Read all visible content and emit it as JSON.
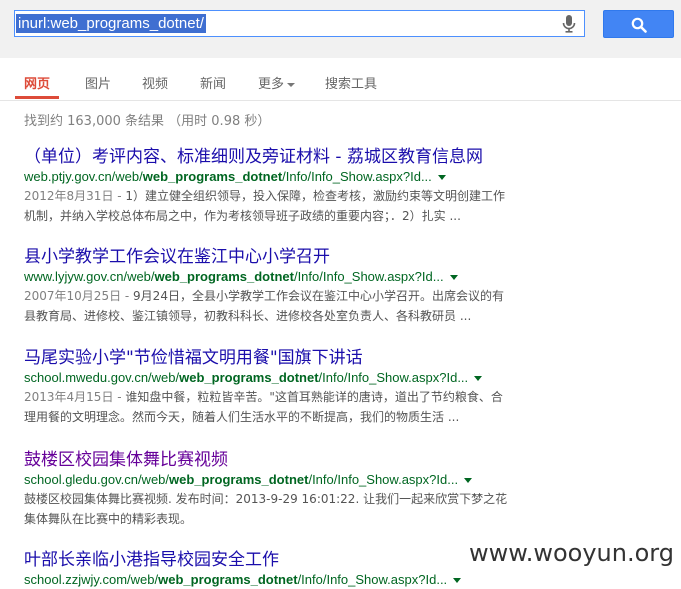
{
  "search": {
    "query": "inurl:web_programs_dotnet/"
  },
  "tabs": [
    {
      "label": "网页"
    },
    {
      "label": "图片"
    },
    {
      "label": "视频"
    },
    {
      "label": "新闻"
    },
    {
      "label": "更多"
    },
    {
      "label": "搜索工具"
    }
  ],
  "stats": "找到约 163,000 条结果 （用时 0.98 秒）",
  "results": [
    {
      "title": "（单位）考评内容、标准细则及旁证材料 - 荔城区教育信息网",
      "url_pre": "web.ptjy.gov.cn/web/",
      "url_bold": "web_programs_dotnet",
      "url_post": "/Info/Info_Show.aspx?Id...",
      "date": "2012年8月31日 - ",
      "line1": "1）建立健全组织领导，投入保障，检查考核，激励约束等文明创建工作",
      "line2": "机制，并纳入学校总体布局之中，作为考核领导班子政绩的重要内容；．2）扎实 ..."
    },
    {
      "title": "县小学教学工作会议在鉴江中心小学召开",
      "url_pre": "www.lyjyw.gov.cn/web/",
      "url_bold": "web_programs_dotnet",
      "url_post": "/Info/Info_Show.aspx?Id...",
      "date": "2007年10月25日 - ",
      "line1": "9月24日，全县小学教学工作会议在鉴江中心小学召开。出席会议的有",
      "line2": "县教育局、进修校、鉴江镇领导，初教科科长、进修校各处室负责人、各科教研员 ..."
    },
    {
      "title": "马尾实验小学\"节俭惜福文明用餐\"国旗下讲话",
      "url_pre": "school.mwedu.gov.cn/web/",
      "url_bold": "web_programs_dotnet",
      "url_post": "/Info/Info_Show.aspx?Id...",
      "date": "2013年4月15日 - ",
      "line1": "谁知盘中餐，粒粒皆辛苦。\"这首耳熟能详的唐诗，道出了节约粮食、合",
      "line2": "理用餐的文明理念。然而今天，随着人们生活水平的不断提高，我们的物质生活 ..."
    },
    {
      "title": "鼓楼区校园集体舞比赛视频",
      "url_pre": "school.gledu.gov.cn/web/",
      "url_bold": "web_programs_dotnet",
      "url_post": "/Info/Info_Show.aspx?Id...",
      "date": "",
      "line1": "鼓楼区校园集体舞比赛视频. 发布时间：2013-9-29 16:01:22. 让我们一起来欣赏下梦之花",
      "line2": "集体舞队在比赛中的精彩表现。"
    },
    {
      "title": "叶部长亲临小港指导校园安全工作",
      "url_pre": "school.zzjwjy.com/web/",
      "url_bold": "web_programs_dotnet",
      "url_post": "/Info/Info_Show.aspx?Id...",
      "date": "",
      "line1": "",
      "line2": ""
    }
  ],
  "watermark": "www.wooyun.org",
  "colors": {
    "link": "#1a0dab",
    "visited": "#660099",
    "url": "#006621",
    "active_tab": "#dd4b39",
    "search_button": "#4285f4"
  },
  "icons": [
    "microphone-icon",
    "search-icon",
    "dropdown-arrow-icon"
  ]
}
